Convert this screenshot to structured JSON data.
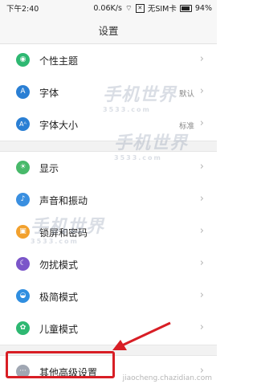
{
  "status_bar": {
    "time": "下午2:40",
    "speed": "0.06K/s",
    "sim": "无SIM卡",
    "battery": "94%"
  },
  "title": "设置",
  "items_group1": [
    {
      "label": "个性主题",
      "value": "",
      "icon": "theme-icon",
      "color": "#2eb872",
      "glyph": "◉"
    },
    {
      "label": "字体",
      "value": "默认",
      "icon": "font-icon",
      "color": "#2a7fd4",
      "glyph": "A"
    },
    {
      "label": "字体大小",
      "value": "标准",
      "icon": "font-size-icon",
      "color": "#2a7fd4",
      "glyph": "Aᴬ"
    }
  ],
  "items_group2": [
    {
      "label": "显示",
      "value": "",
      "icon": "display-icon",
      "color": "#48b96a",
      "glyph": "☀"
    },
    {
      "label": "声音和振动",
      "value": "",
      "icon": "sound-icon",
      "color": "#3a8fe0",
      "glyph": "♪"
    },
    {
      "label": "锁屏和密码",
      "value": "",
      "icon": "lock-icon",
      "color": "#f2a12e",
      "glyph": "🔒"
    },
    {
      "label": "勿扰模式",
      "value": "",
      "icon": "do-not-disturb-icon",
      "color": "#7b56c9",
      "glyph": "☾"
    },
    {
      "label": "极简模式",
      "value": "",
      "icon": "simple-mode-icon",
      "color": "#2f8ee0",
      "glyph": "◒"
    },
    {
      "label": "儿童模式",
      "value": "",
      "icon": "kids-mode-icon",
      "color": "#2eb872",
      "glyph": "✿"
    },
    {
      "label": "其他高级设置",
      "value": "",
      "icon": "more-settings-icon",
      "color": "#a0a7b3",
      "glyph": "···"
    }
  ],
  "watermark": {
    "brand": "手机世界",
    "num": "3533.com",
    "footer": "jiaocheng.chazidian.com"
  },
  "accent_red": "#d81e25"
}
